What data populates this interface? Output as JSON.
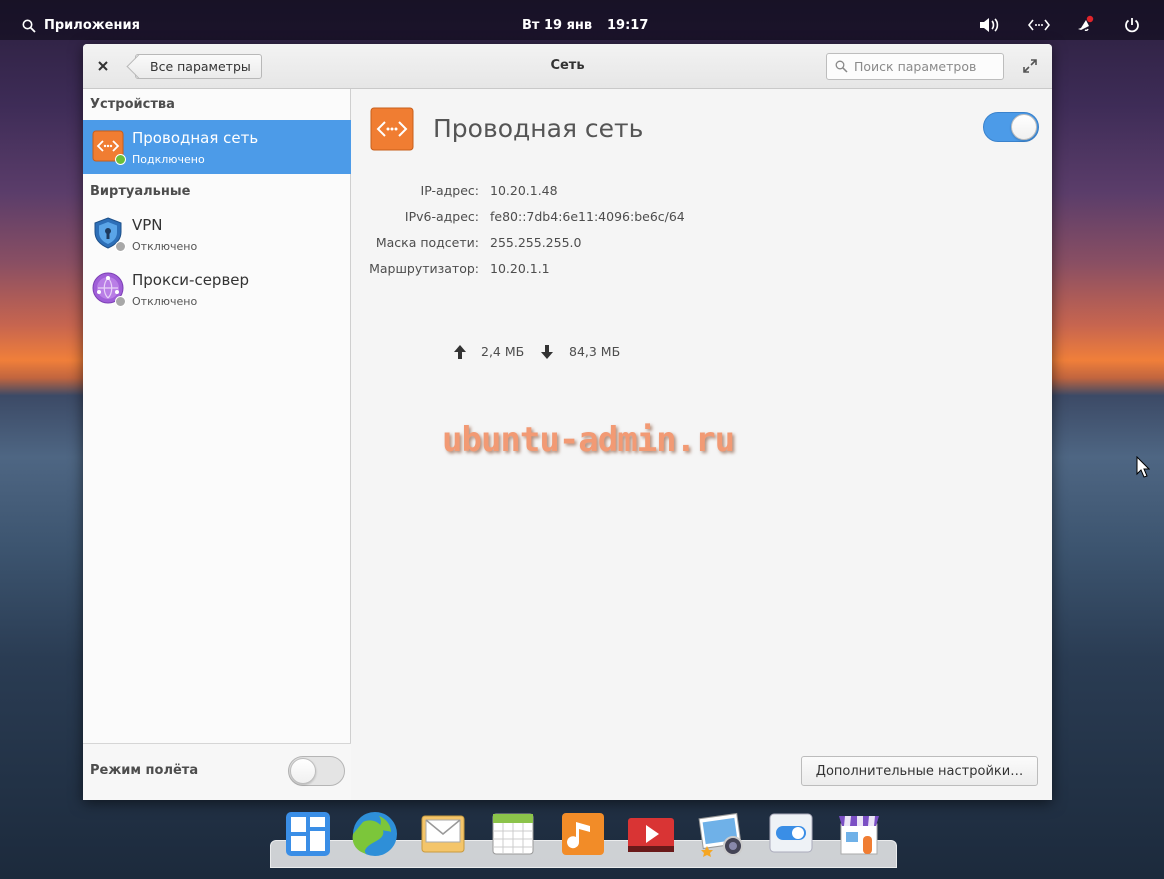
{
  "top_panel": {
    "apps_label": "Приложения",
    "date": "Вт 19 янв",
    "time": "19:17"
  },
  "window": {
    "title": "Сеть",
    "back_label": "Все параметры",
    "search_placeholder": "Поиск параметров"
  },
  "sidebar": {
    "devices_header": "Устройства",
    "virtual_header": "Виртуальные",
    "items": [
      {
        "label": "Проводная сеть",
        "status": "Подключено",
        "active": true
      },
      {
        "label": "VPN",
        "status": "Отключено",
        "active": false
      },
      {
        "label": "Прокси-сервер",
        "status": "Отключено",
        "active": false
      }
    ],
    "airplane_label": "Режим полёта",
    "airplane_enabled": false
  },
  "content": {
    "title": "Проводная сеть",
    "enabled": true,
    "info": [
      {
        "key": "IP-адрес:",
        "value": "10.20.1.48"
      },
      {
        "key": "IPv6-адрес:",
        "value": "fe80::7db4:6e11:4096:be6c/64"
      },
      {
        "key": "Маска подсети:",
        "value": "255.255.255.0"
      },
      {
        "key": "Маршрутизатор:",
        "value": "10.20.1.1"
      }
    ],
    "upload": "2,4 МБ",
    "download": "84,3 МБ",
    "advanced_button": "Дополнительные настройки…"
  },
  "watermark": "ubuntu-admin.ru",
  "colors": {
    "accent": "#4c9be8",
    "device_orange": "#f07d32",
    "status_connected": "#6abf3a",
    "status_disconnected": "#a8a8a8"
  },
  "dock": {
    "icons": [
      "multitasking-view-icon",
      "web-browser-icon",
      "mail-icon",
      "calendar-icon",
      "music-icon",
      "videos-icon",
      "photos-icon",
      "system-settings-icon",
      "app-center-icon"
    ]
  }
}
